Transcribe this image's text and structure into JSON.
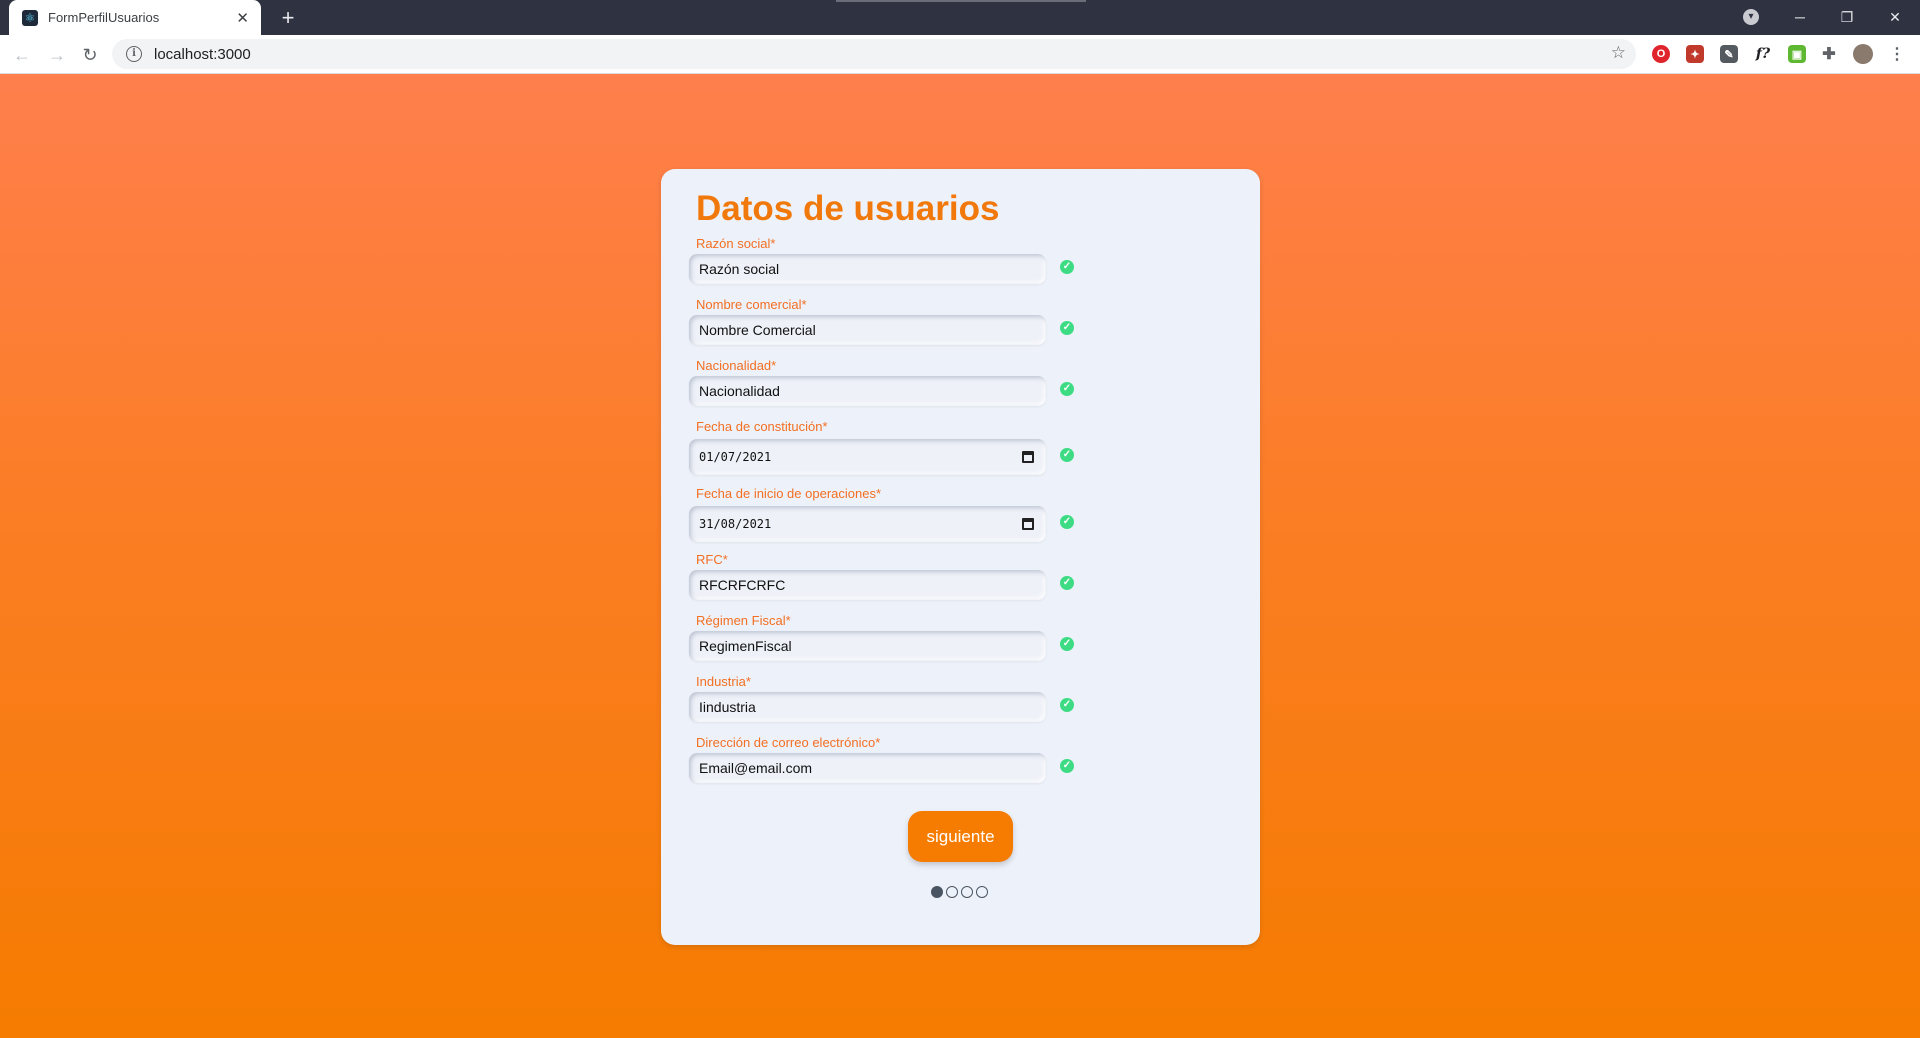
{
  "browser": {
    "tab_title": "FormPerfilUsuarios",
    "tab_close": "✕",
    "new_tab": "+",
    "url": "localhost:3000",
    "window_controls": {
      "minimize": "─",
      "restore": "❐",
      "close": "✕"
    },
    "extensions": [
      {
        "name": "opera-extension-icon",
        "color": "#e0242b"
      },
      {
        "name": "ublock-extension-icon",
        "color": "#c0392b"
      },
      {
        "name": "eyedropper-extension-icon",
        "color": "#555a60"
      },
      {
        "name": "function-extension-icon",
        "color": "#202124"
      },
      {
        "name": "green-extension-icon",
        "color": "#5fb832"
      },
      {
        "name": "puzzle-extension-icon",
        "color": "#5f6368"
      }
    ]
  },
  "form": {
    "title": "Datos de usuarios",
    "fields": [
      {
        "label": "Razón social*",
        "value": "Razón social",
        "type": "text"
      },
      {
        "label": "Nombre comercial*",
        "value": "Nombre Comercial",
        "type": "text"
      },
      {
        "label": "Nacionalidad*",
        "value": "Nacionalidad",
        "type": "text"
      },
      {
        "label": "Fecha de constitución*",
        "value": "01/07/2021",
        "type": "date"
      },
      {
        "label": "Fecha de inicio de operaciones*",
        "value": "31/08/2021",
        "type": "date"
      },
      {
        "label": "RFC*",
        "value": "RFCRFCRFC",
        "type": "text"
      },
      {
        "label": "Régimen Fiscal*",
        "value": "RegimenFiscal",
        "type": "text"
      },
      {
        "label": "Industria*",
        "value": "Iindustria",
        "type": "text"
      },
      {
        "label": "Dirección de correo electrónico*",
        "value": "Email@email.com",
        "type": "text"
      }
    ],
    "next_button": "siguiente",
    "steps": {
      "total": 4,
      "current": 1
    }
  },
  "colors": {
    "accent": "#f57c00",
    "title": "#f1780a",
    "label": "#f26f23",
    "valid_check": "#3ddc84",
    "card_bg": "#edf1f9"
  }
}
